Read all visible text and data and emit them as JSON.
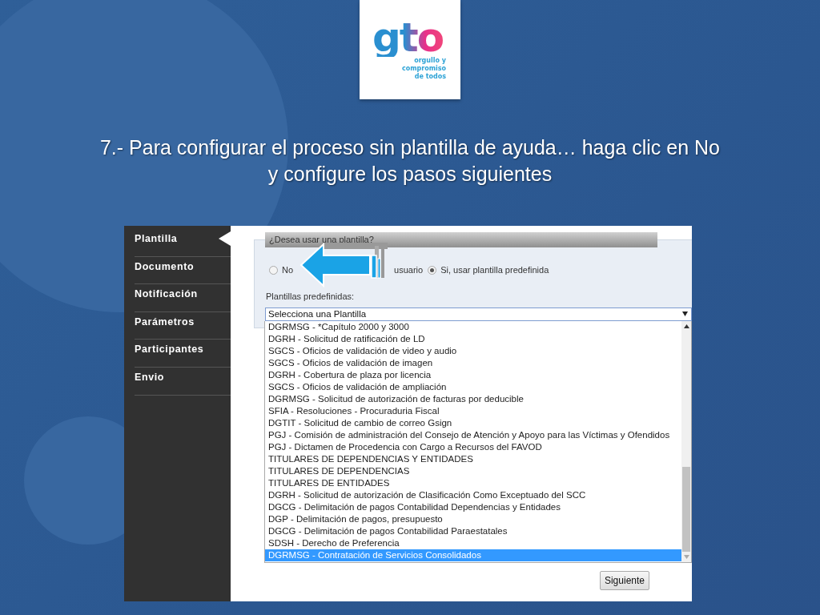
{
  "slide": {
    "logo": {
      "wordmark": "gto",
      "tagline": "orgullo y compromiso de todos"
    },
    "title": "7.- Para configurar el proceso sin plantilla de ayuda… haga clic en No y configure los pasos siguientes"
  },
  "sidebar": {
    "items": [
      {
        "label": "Plantilla",
        "selected": true
      },
      {
        "label": "Documento",
        "selected": false
      },
      {
        "label": "Notificación",
        "selected": false
      },
      {
        "label": "Parámetros",
        "selected": false
      },
      {
        "label": "Participantes",
        "selected": false
      },
      {
        "label": "Envio",
        "selected": false
      }
    ]
  },
  "form": {
    "question": "¿Desea usar una plantilla?",
    "radios": [
      {
        "label": "No",
        "checked": false
      },
      {
        "label": "usuario"
      },
      {
        "label": "Si, usar plantilla predefinida",
        "checked": true
      }
    ],
    "select_label": "Plantillas predefinidas:",
    "select_value": "Selecciona una Plantilla",
    "options": [
      {
        "label": "DGRMSG - *Capítulo 2000 y 3000",
        "selected": false
      },
      {
        "label": "DGRH - Solicitud de ratificación de LD",
        "selected": false
      },
      {
        "label": "SGCS - Oficios de validación de video y audio",
        "selected": false
      },
      {
        "label": "SGCS - Oficios de validación de imagen",
        "selected": false
      },
      {
        "label": "DGRH - Cobertura de plaza por licencia",
        "selected": false
      },
      {
        "label": "SGCS - Oficios de validación de ampliación",
        "selected": false
      },
      {
        "label": "DGRMSG - Solicitud de autorización de facturas por deducible",
        "selected": false
      },
      {
        "label": "SFIA - Resoluciones - Procuraduria Fiscal",
        "selected": false
      },
      {
        "label": "DGTIT - Solicitud de cambio de correo Gsign",
        "selected": false
      },
      {
        "label": "PGJ - Comisión de administración del Consejo de Atención y Apoyo para las Víctimas y Ofendidos",
        "selected": false
      },
      {
        "label": "PGJ - Dictamen de Procedencia con Cargo a Recursos del FAVOD",
        "selected": false
      },
      {
        "label": "TITULARES DE DEPENDENCIAS Y ENTIDADES",
        "selected": false
      },
      {
        "label": "TITULARES DE DEPENDENCIAS",
        "selected": false
      },
      {
        "label": "TITULARES DE ENTIDADES",
        "selected": false
      },
      {
        "label": "DGRH - Solicitud de autorización de Clasificación Como Exceptuado del SCC",
        "selected": false
      },
      {
        "label": "DGCG - Delimitación de pagos Contabilidad Dependencias y Entidades",
        "selected": false
      },
      {
        "label": "DGP - Delimitación de pagos, presupuesto",
        "selected": false
      },
      {
        "label": "DGCG - Delimitación de pagos Contabilidad Paraestatales",
        "selected": false
      },
      {
        "label": "SDSH - Derecho de Preferencia",
        "selected": false
      },
      {
        "label": "DGRMSG - Contratación de Servicios Consolidados",
        "selected": true
      }
    ],
    "button": "Siguiente"
  }
}
